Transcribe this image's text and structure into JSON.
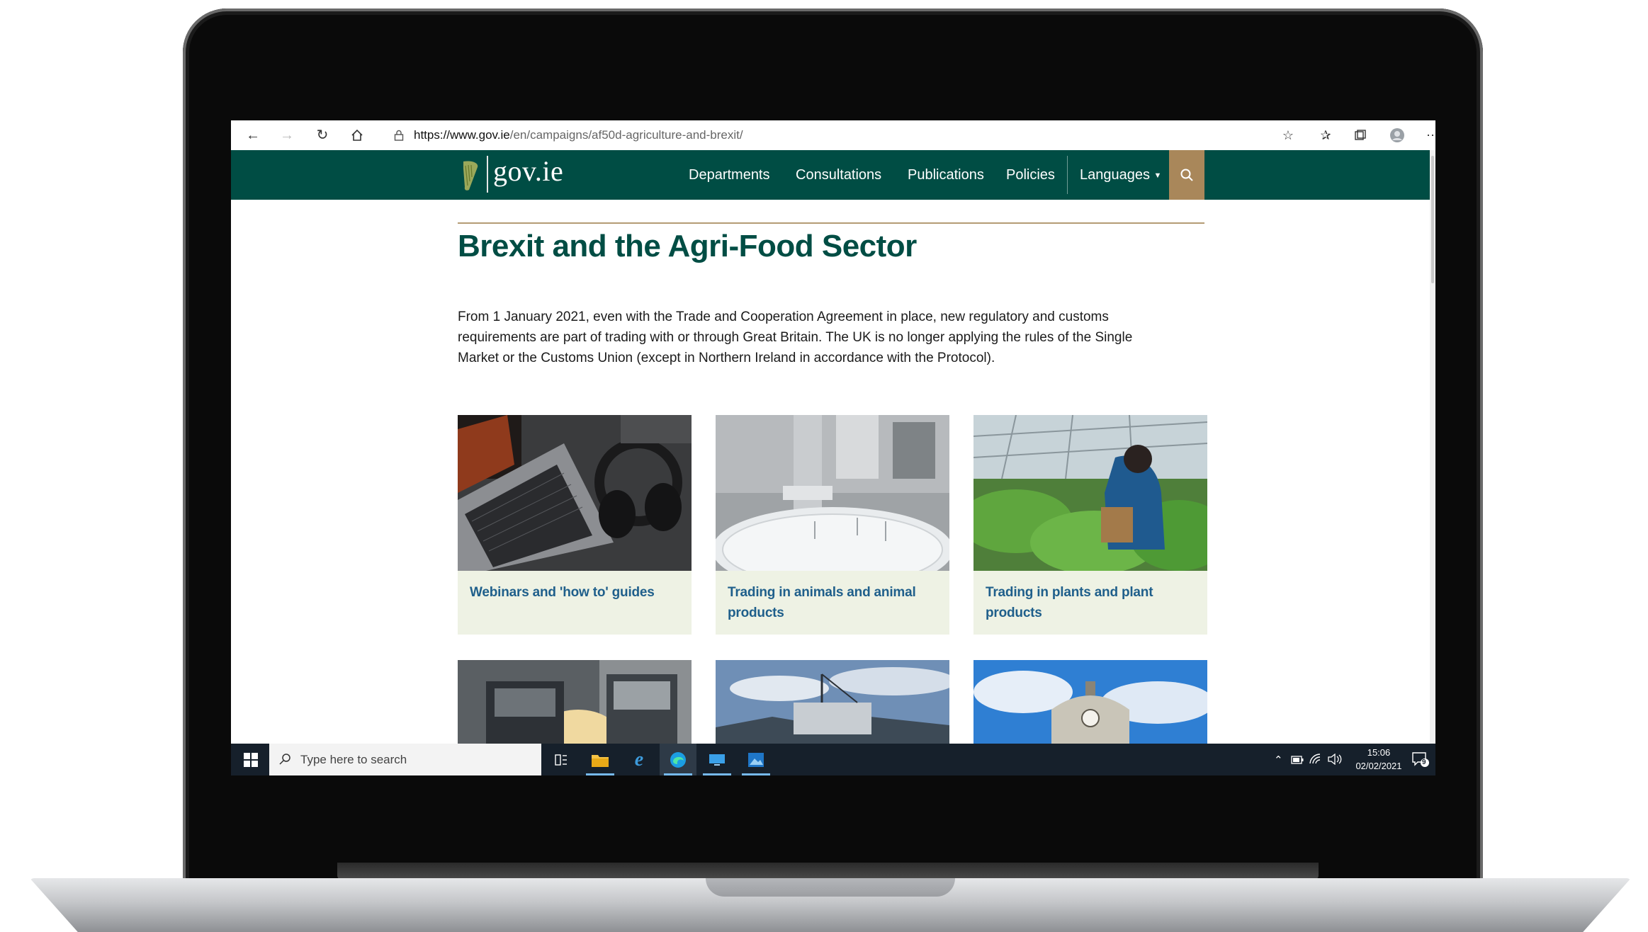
{
  "browser": {
    "url_host": "https://www.gov.ie",
    "url_path": "/en/campaigns/af50d-agriculture-and-brexit/",
    "icons": [
      "back-icon",
      "forward-icon",
      "refresh-icon",
      "home-icon",
      "lock-icon",
      "add-favorite-icon",
      "favorites-icon",
      "collections-icon",
      "profile-icon",
      "more-icon"
    ]
  },
  "site": {
    "logo_text": "gov.ie",
    "nav": [
      {
        "label": "Departments"
      },
      {
        "label": "Consultations"
      },
      {
        "label": "Publications"
      },
      {
        "label": "Policies"
      }
    ],
    "languages_label": "Languages",
    "brand_color": "#004d44",
    "search_color": "#a9875a"
  },
  "page": {
    "title": "Brexit and the Agri-Food Sector",
    "intro": "From 1 January 2021, even with the Trade and Cooperation Agreement in place, new regulatory and customs requirements are part of trading with or through Great Britain. The UK is no longer applying the rules of the Single Market or the Customs Union (except in Northern Ireland in accordance with the Protocol).",
    "cards": [
      {
        "label": "Webinars and 'how to' guides"
      },
      {
        "label": "Trading in animals and animal products"
      },
      {
        "label": "Trading in plants and plant products"
      }
    ]
  },
  "taskbar": {
    "search_placeholder": "Type here to search",
    "time": "15:06",
    "date": "02/02/2021",
    "notification_count": "9"
  }
}
